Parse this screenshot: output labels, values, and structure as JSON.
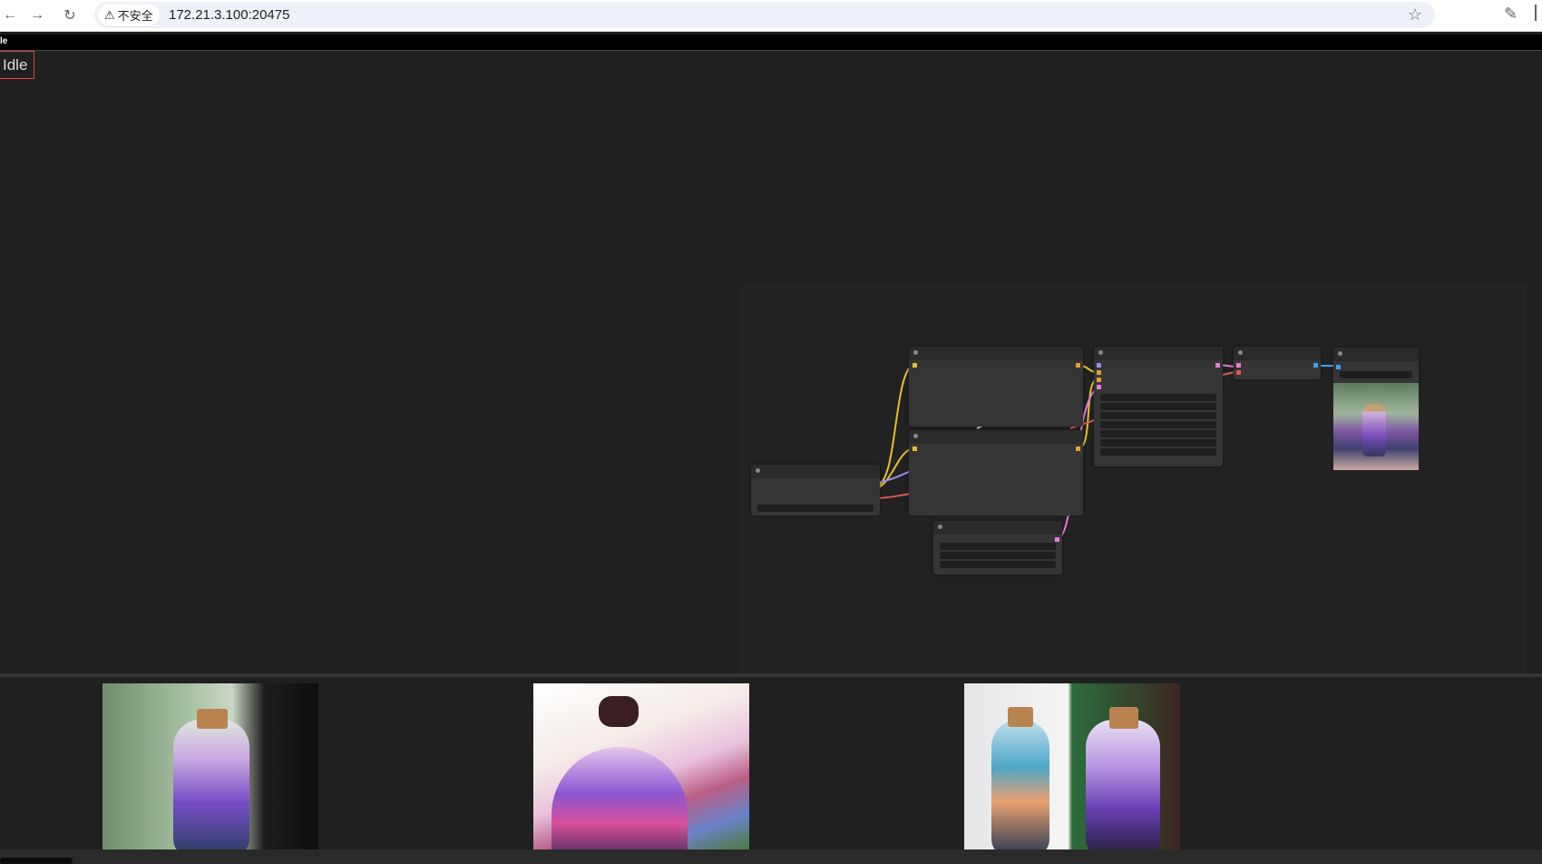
{
  "browser": {
    "security_label": "不安全",
    "url": "172.21.3.100:20475",
    "icons": [
      "back-arrow-icon",
      "forward-arrow-icon",
      "reload-icon",
      "warning-icon",
      "star-icon",
      "extensions-icon"
    ]
  },
  "app": {
    "top_strip_label": "le",
    "status": "Idle"
  },
  "colors": {
    "background": "#202020",
    "node_body": "#353535",
    "link_yellow": "#e6c029",
    "link_pink": "#e87ad7",
    "link_red": "#e05a4f",
    "link_purple": "#9b8be8",
    "link_blue": "#3da3f0",
    "status_border": "#dd4444"
  },
  "gallery": {
    "images": [
      "bottle-forest-galaxy",
      "bottle-sunset-valley",
      "bottle-pair-lake-galaxy"
    ]
  }
}
